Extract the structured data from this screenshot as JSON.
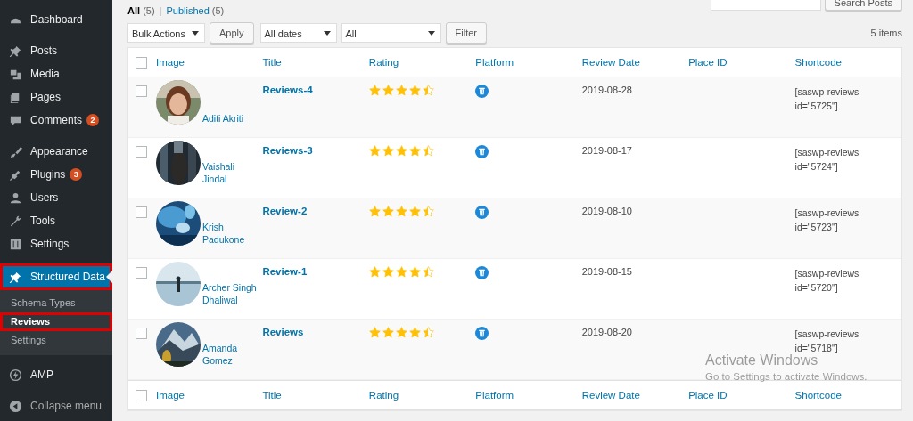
{
  "sidebar": {
    "groups": [
      [
        {
          "label": "Dashboard",
          "selected": false,
          "annotated": false
        }
      ],
      [
        {
          "label": "Posts",
          "selected": false,
          "annotated": false
        },
        {
          "label": "Media",
          "selected": false,
          "annotated": false
        },
        {
          "label": "Pages",
          "selected": false,
          "annotated": false
        },
        {
          "label": "Comments",
          "badge": "2",
          "selected": false,
          "annotated": false
        }
      ],
      [
        {
          "label": "Appearance",
          "selected": false,
          "annotated": false
        },
        {
          "label": "Plugins",
          "badge": "3",
          "selected": false,
          "annotated": false
        },
        {
          "label": "Users",
          "selected": false,
          "annotated": false
        },
        {
          "label": "Tools",
          "selected": false,
          "annotated": false
        },
        {
          "label": "Settings",
          "selected": false,
          "annotated": false
        }
      ],
      [
        {
          "label": "Structured Data",
          "selected": true,
          "annotated": true,
          "children": [
            {
              "label": "Schema Types",
              "selected": false,
              "annotated": false
            },
            {
              "label": "Reviews",
              "selected": true,
              "annotated": true
            },
            {
              "label": "Settings",
              "selected": false,
              "annotated": false
            }
          ]
        }
      ],
      [
        {
          "label": "AMP",
          "selected": false,
          "annotated": false
        }
      ]
    ],
    "collapse": "Collapse menu"
  },
  "search": {
    "button": "Search Posts"
  },
  "views": [
    {
      "label": "All",
      "count": "(5)",
      "selected": true
    },
    {
      "label": "Published",
      "count": "(5)",
      "selected": false
    }
  ],
  "views_separator": "|",
  "filters": {
    "bulk": "Bulk Actions",
    "apply": "Apply",
    "dates": "All dates",
    "type": "All",
    "filter": "Filter",
    "count": "5 items"
  },
  "table": {
    "header_checked": false,
    "columns": [
      "Image",
      "Title",
      "Rating",
      "Platform",
      "Review Date",
      "Place ID",
      "Shortcode"
    ],
    "footer_checked": false,
    "footer_columns": [
      "Image",
      "Title",
      "Rating",
      "Platform",
      "Review Date",
      "Place ID",
      "Shortcode"
    ],
    "rows": [
      {
        "checked": false,
        "name": "Aditi Akriti",
        "title": "Reviews-4",
        "stars": 4.5,
        "date": "2019-08-28",
        "shortcode": "[saswp-reviews id=\"5725\"]"
      },
      {
        "checked": false,
        "name": "Vaishali Jindal",
        "title": "Reviews-3",
        "stars": 4.5,
        "date": "2019-08-17",
        "shortcode": "[saswp-reviews id=\"5724\"]"
      },
      {
        "checked": false,
        "name": "Krish Padukone",
        "title": "Review-2",
        "stars": 4.5,
        "date": "2019-08-10",
        "shortcode": "[saswp-reviews id=\"5723\"]"
      },
      {
        "checked": false,
        "name": "Archer Singh Dhaliwal",
        "title": "Review-1",
        "stars": 4.5,
        "date": "2019-08-15",
        "shortcode": "[saswp-reviews id=\"5720\"]"
      },
      {
        "checked": false,
        "name": "Amanda Gomez",
        "title": "Reviews",
        "stars": 4.5,
        "date": "2019-08-20",
        "shortcode": "[saswp-reviews id=\"5718\"]"
      }
    ]
  },
  "os_notice": {
    "title": "Activate Windows",
    "text": "Go to Settings to activate Windows."
  }
}
